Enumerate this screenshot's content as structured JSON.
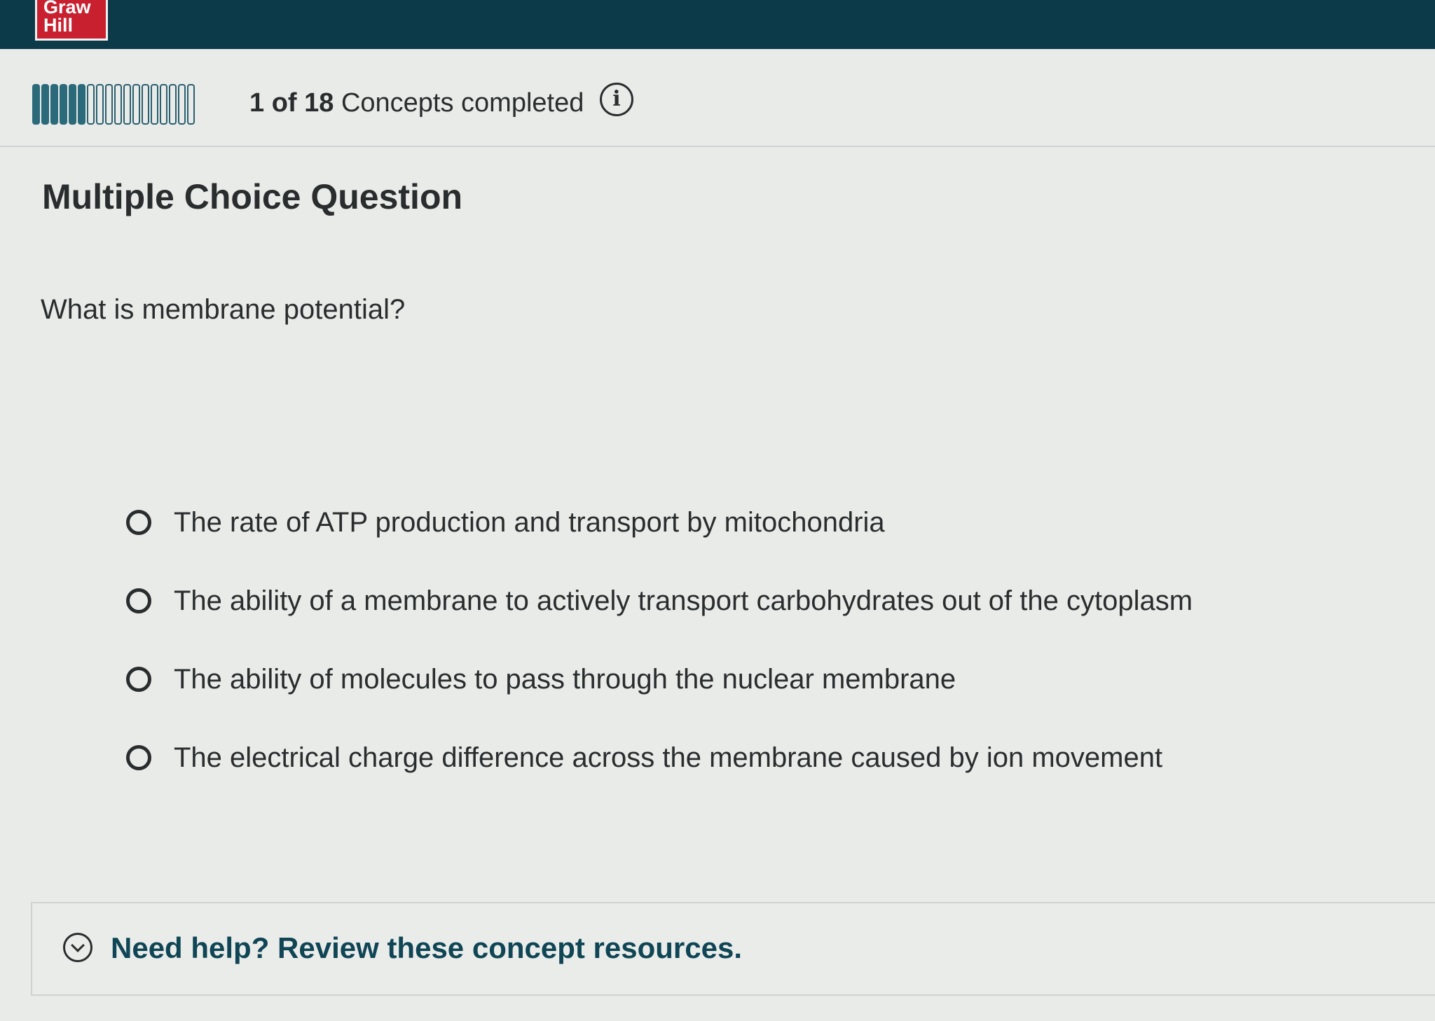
{
  "header": {
    "logo_line1": "Graw",
    "logo_line2": "Hill",
    "brand_color": "#0c3a48",
    "logo_color": "#c8202f"
  },
  "progress": {
    "completed": "1 of 18",
    "suffix": "Concepts completed",
    "total_segments": 18,
    "filled_segments": 6,
    "info_icon": "info-icon"
  },
  "question": {
    "type_label": "Multiple Choice Question",
    "prompt": "What is membrane potential?",
    "options": [
      {
        "label": "The rate of ATP production and transport by mitochondria",
        "selected": false
      },
      {
        "label": "The ability of a membrane to actively transport carbohydrates out of the cytoplasm",
        "selected": false
      },
      {
        "label": "The ability of molecules to pass through the nuclear membrane",
        "selected": false
      },
      {
        "label": "The electrical charge difference across the membrane caused by ion movement",
        "selected": false
      }
    ]
  },
  "help": {
    "label": "Need help? Review these concept resources.",
    "icon": "chevron-down-circle-icon",
    "color": "#0f4554"
  }
}
